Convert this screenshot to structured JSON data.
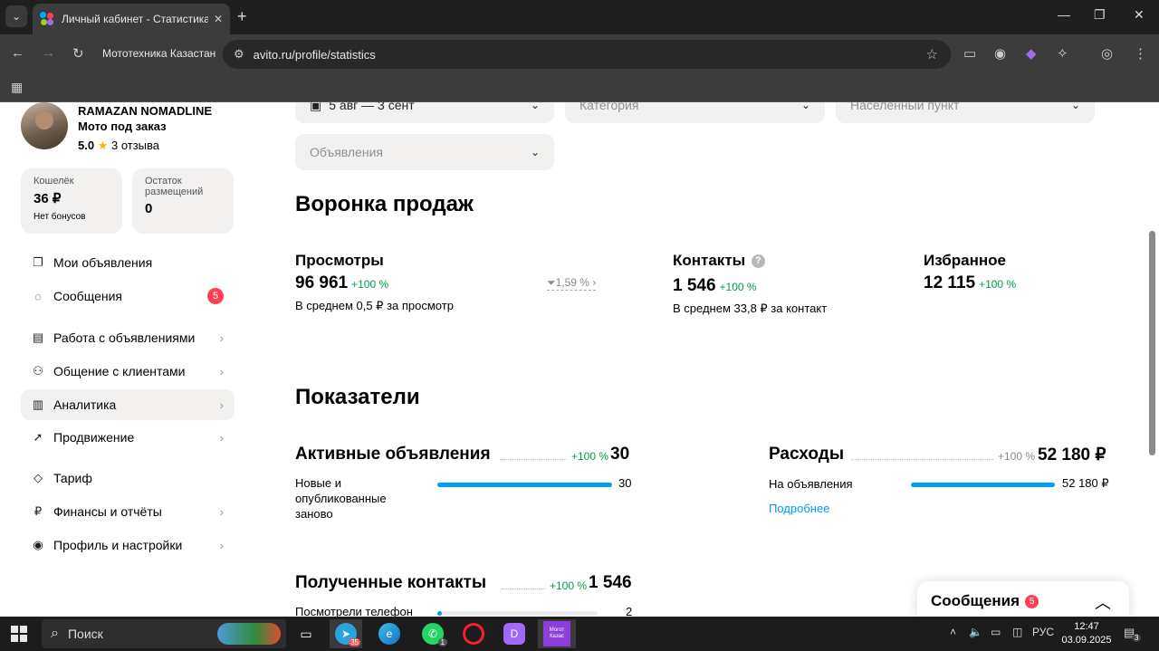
{
  "browser": {
    "tab_title": "Личный кабинет - Статистика - Ав",
    "tab_close": "✕",
    "new_tab": "+",
    "window_controls": [
      "—",
      "❐",
      "✕"
    ],
    "bookmark": "Мототехника Казастан",
    "url": "avito.ru/profile/statistics"
  },
  "user": {
    "name": "RAMAZAN NOMADLINE",
    "subtitle": "Мото под заказ",
    "rating": "5.0",
    "reviews": "3 отзыва"
  },
  "wallet": {
    "label": "Кошелёк",
    "value": "36 ₽",
    "note": "Нет бонусов"
  },
  "placements": {
    "label": "Остаток размещений",
    "value": "0"
  },
  "nav": [
    {
      "label": "Мои объявления",
      "icon": "copy-icon"
    },
    {
      "label": "Сообщения",
      "icon": "chat-icon",
      "badge": "5"
    },
    {
      "label": "Работа с объявлениями",
      "icon": "list-icon"
    },
    {
      "label": "Общение с клиентами",
      "icon": "users-icon"
    },
    {
      "label": "Аналитика",
      "icon": "chart-icon"
    },
    {
      "label": "Продвижение",
      "icon": "rocket-icon"
    },
    {
      "label": "Тариф",
      "icon": "diamond-icon"
    },
    {
      "label": "Финансы и отчёты",
      "icon": "ruble-icon"
    },
    {
      "label": "Профиль и настройки",
      "icon": "profile-icon"
    }
  ],
  "filters": {
    "date": "5 авг — 3 сент",
    "category": "Категория",
    "location": "Населенный пункт",
    "ads": "Объявления"
  },
  "funnel": {
    "title": "Воронка продаж",
    "views": {
      "title": "Просмотры",
      "value": "96 961",
      "delta": "+100 %",
      "avg": "В среднем 0,5 ₽ за просмотр"
    },
    "conversion": "1,59 %",
    "contacts": {
      "title": "Контакты",
      "value": "1 546",
      "delta": "+100 %",
      "avg": "В среднем 33,8 ₽ за контакт"
    },
    "favorites": {
      "title": "Избранное",
      "value": "12 115",
      "delta": "+100 %"
    }
  },
  "indicators": {
    "title": "Показатели",
    "active": {
      "title": "Активные объявления",
      "delta": "+100 %",
      "value": "30",
      "row_label": "Новые и опубликованные заново",
      "row_value": "30",
      "fraction": 1.0
    },
    "expenses": {
      "title": "Расходы",
      "delta": "+100 %",
      "value": "52 180 ₽",
      "row_label": "На объявления",
      "row_value": "52 180 ₽",
      "fraction": 1.0,
      "link": "Подробнее"
    },
    "contacts": {
      "title": "Полученные контакты",
      "delta": "+100 %",
      "value": "1 546",
      "row_label": "Посмотрели телефон",
      "row_value": "2",
      "fraction": 0.02
    }
  },
  "messages_panel": {
    "title": "Сообщения",
    "badge": "5"
  },
  "taskbar": {
    "search": "Поиск",
    "telegram_badge": "35",
    "whatsapp_badge": "1",
    "app_label": "Могот Казас",
    "lang": "РУС",
    "time": "12:47",
    "date": "03.09.2025",
    "notif": "3"
  },
  "colors": {
    "accent_green": "#00a046",
    "accent_blue": "#00a0f0",
    "badge_red": "#ff4053"
  }
}
